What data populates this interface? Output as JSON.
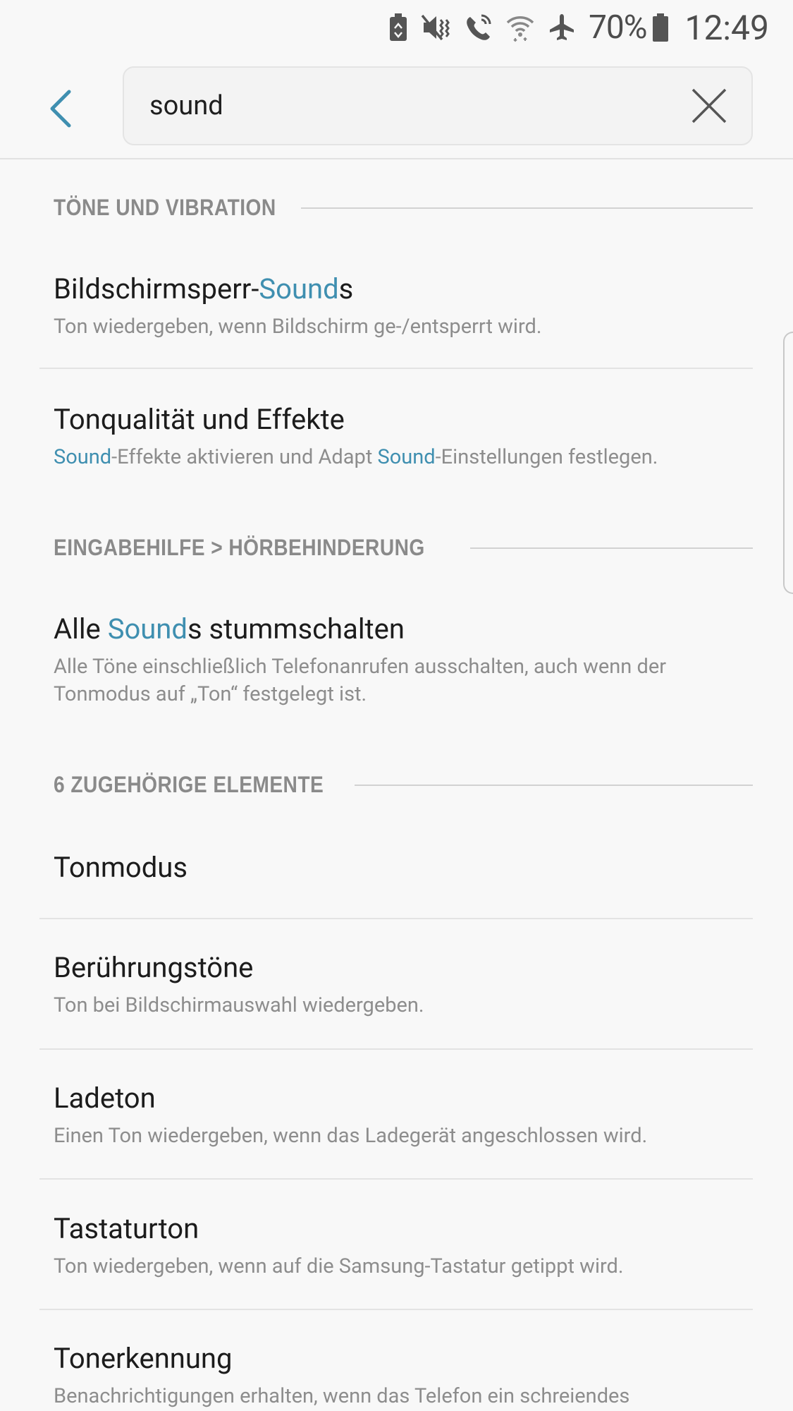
{
  "status_bar": {
    "battery_percent": "70%",
    "time": "12:49",
    "icons": [
      "battery-saver-icon",
      "vibrate-mute-icon",
      "wifi-call-icon",
      "wifi-icon",
      "airplane-icon",
      "battery-icon"
    ]
  },
  "search": {
    "value": "sound",
    "placeholder": ""
  },
  "sections": [
    {
      "title": "TÖNE UND VIBRATION",
      "items": [
        {
          "title_parts": [
            "Bildschirmsperr-",
            "Sound",
            "s"
          ],
          "subtitle": "Ton wiedergeben, wenn Bildschirm ge-/entsperrt wird."
        },
        {
          "title": "Tonqualität und Effekte",
          "subtitle_parts": [
            "Sound",
            "-Effekte aktivieren und Adapt ",
            "Sound",
            "-Einstellungen festlegen."
          ]
        }
      ]
    },
    {
      "title": "EINGABEHILFE > HÖRBEHINDERUNG",
      "items": [
        {
          "title_parts": [
            "Alle ",
            "Sound",
            "s stummschalten"
          ],
          "subtitle_lines": [
            "Alle Töne einschließlich Telefonanrufen ausschalten, auch wenn der",
            "Tonmodus auf „Ton“ festgelegt ist."
          ]
        }
      ]
    },
    {
      "title": "6 ZUGEHÖRIGE ELEMENTE",
      "items": [
        {
          "title": "Tonmodus",
          "subtitle": ""
        },
        {
          "title": "Berührungstöne",
          "subtitle": "Ton bei Bildschirmauswahl wiedergeben."
        },
        {
          "title": "Ladeton",
          "subtitle": "Einen Ton wiedergeben, wenn das Ladegerät angeschlossen wird."
        },
        {
          "title": "Tastaturton",
          "subtitle": "Ton wiedergeben, wenn auf die Samsung-Tastatur getippt wird."
        },
        {
          "title": "Tonerkennung",
          "subtitle": "Benachrichtigungen erhalten, wenn das Telefon ein schreiendes"
        }
      ]
    }
  ],
  "colors": {
    "accent": "#3f8fb0",
    "background": "#f8f8f8",
    "section_title": "#8a8a8a",
    "subtitle": "#8d8d8d"
  }
}
